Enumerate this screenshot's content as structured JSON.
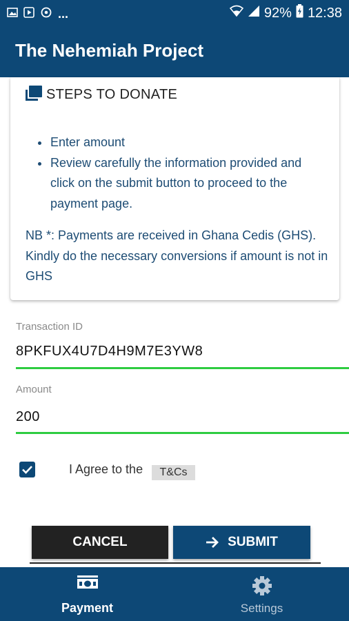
{
  "status_bar": {
    "overflow": "...",
    "battery": "92%",
    "time": "12:38",
    "icons": [
      "image-icon",
      "play-store-icon",
      "sync-icon",
      "wifi-icon",
      "signal-icon",
      "battery-icon"
    ]
  },
  "app_bar": {
    "title": "The Nehemiah Project"
  },
  "steps": {
    "icon": "book-icon",
    "title": "STEPS TO DONATE",
    "items": [
      "Enter amount",
      "Review carefully the information provided and click on the submit button to proceed to the payment page."
    ],
    "note": "NB *: Payments are received in Ghana Cedis (GHS). Kindly do the necessary conversions if amount is not in GHS"
  },
  "transaction": {
    "label": "Transaction ID",
    "value": "8PKFUX4U7D4H9M7E3YW8"
  },
  "amount": {
    "label": "Amount",
    "value": "200"
  },
  "agree": {
    "checked": true,
    "text": "I Agree to the",
    "link": "T&Cs"
  },
  "buttons": {
    "cancel": "CANCEL",
    "submit": "SUBMIT"
  },
  "bottom_nav": {
    "payment": {
      "label": "Payment",
      "icon": "money-icon"
    },
    "settings": {
      "label": "Settings",
      "icon": "gear-icon"
    }
  },
  "colors": {
    "primary": "#0d4876",
    "accent_green": "#2ecc40",
    "dark_button": "#222222",
    "step_text": "#1d4c74"
  }
}
